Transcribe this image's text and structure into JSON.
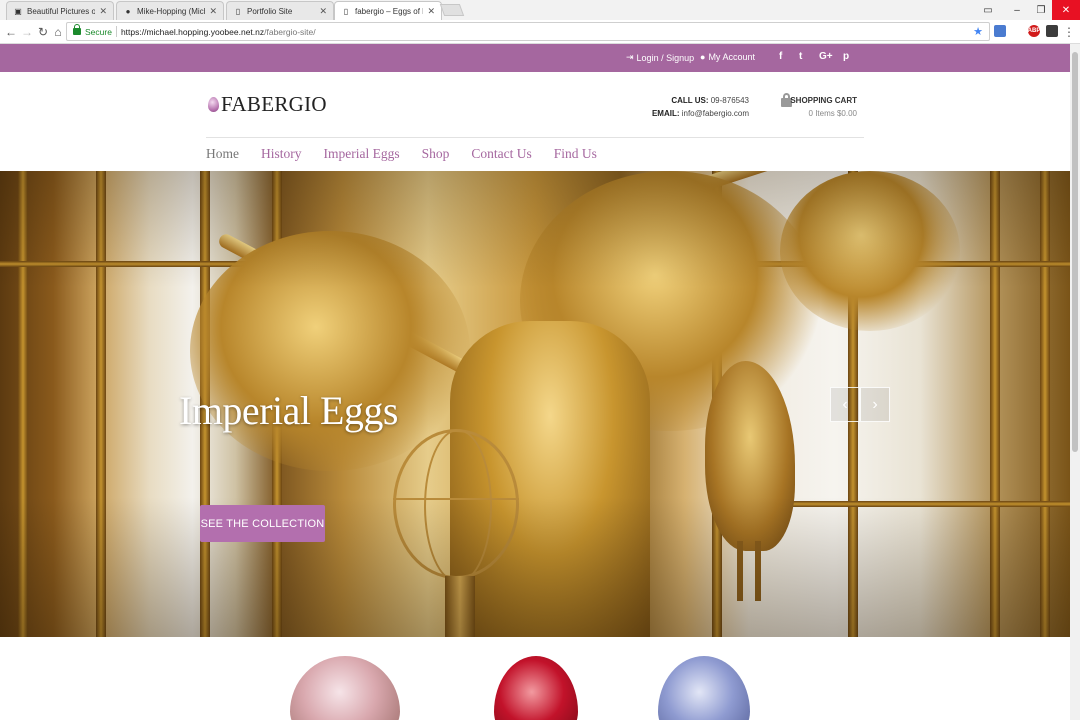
{
  "browser": {
    "tabs": [
      {
        "title": "Beautiful Pictures of the",
        "favicon": "camera-icon",
        "active": false
      },
      {
        "title": "Mike-Hopping (Michael",
        "favicon": "github-icon",
        "active": false
      },
      {
        "title": "Portfolio Site",
        "favicon": "page-icon",
        "active": false
      },
      {
        "title": "fabergio – Eggs of Eggce",
        "favicon": "page-icon",
        "active": true
      }
    ],
    "secure_label": "Secure",
    "url_scheme": "https://",
    "url_host": "michael.hopping.yoobee.net.nz",
    "url_path": "/fabergio-site/",
    "extensions": [
      {
        "label": "",
        "color": "#4a7bd0"
      },
      {
        "label": "ABP",
        "color": "#d11a1a"
      },
      {
        "label": "",
        "color": "#3c3c3c"
      }
    ]
  },
  "topbar": {
    "login_label": "Login / Signup",
    "account_label": "My Account",
    "social": [
      "f",
      "t",
      "G+",
      "p"
    ],
    "color": "#a5679f"
  },
  "brand": {
    "name": "FABERGIO"
  },
  "contact": {
    "call_label": "CALL US:",
    "call_value": "09-876543",
    "email_label": "EMAIL:",
    "email_value": "info@fabergio.com"
  },
  "cart": {
    "title": "SHOPPING CART",
    "summary": "0 Items $0.00"
  },
  "nav": {
    "items": [
      "Home",
      "History",
      "Imperial Eggs",
      "Shop",
      "Contact Us",
      "Find Us"
    ]
  },
  "hero": {
    "title": "Imperial Eggs",
    "cta_label": "SEE THE COLLECTION",
    "prev_label": "‹",
    "next_label": "›",
    "accent": "#b36fae"
  }
}
